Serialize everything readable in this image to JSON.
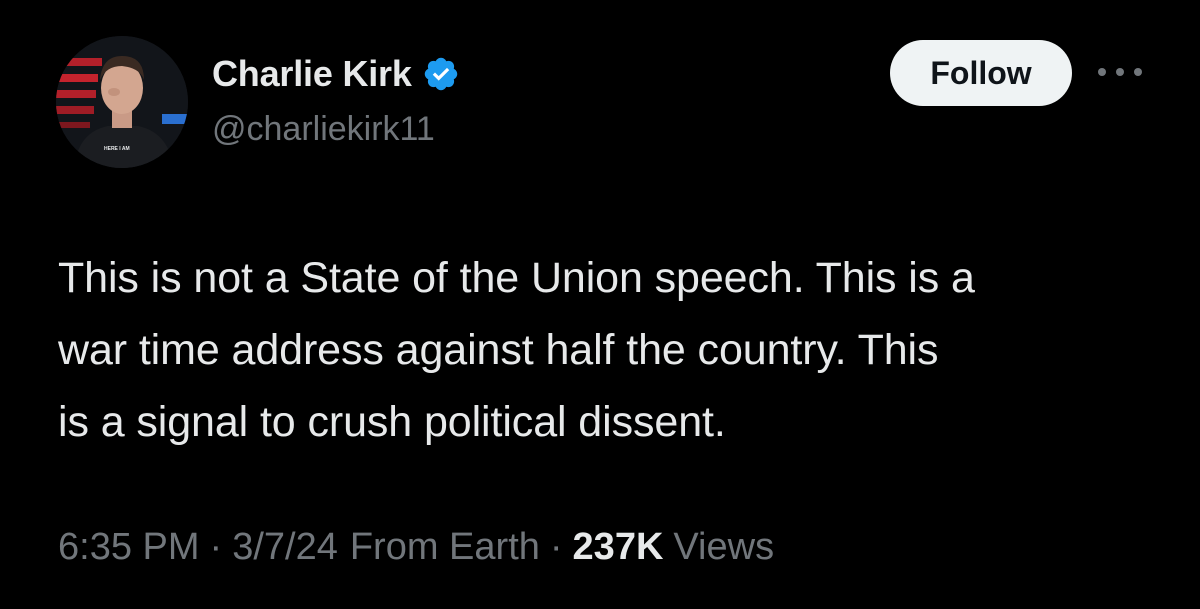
{
  "author": {
    "display_name": "Charlie Kirk",
    "handle": "@charliekirk11",
    "avatar_shirt_text": "HERE I AM"
  },
  "actions": {
    "follow_label": "Follow",
    "more_icon": "more-horizontal-icon"
  },
  "tweet": {
    "lines": [
      "This is not a State of the Union speech. This is a",
      "war time address against half the country. This",
      "is a signal to crush political dissent."
    ]
  },
  "meta": {
    "time": "6:35 PM",
    "separator": "·",
    "date": "3/7/24",
    "location": "From Earth",
    "views_count": "237K",
    "views_label": "Views"
  },
  "colors": {
    "background": "#000000",
    "text_primary": "#e7e9ea",
    "text_secondary": "#71767b",
    "verified_blue": "#1d9bf0",
    "follow_bg": "#eff3f4"
  }
}
